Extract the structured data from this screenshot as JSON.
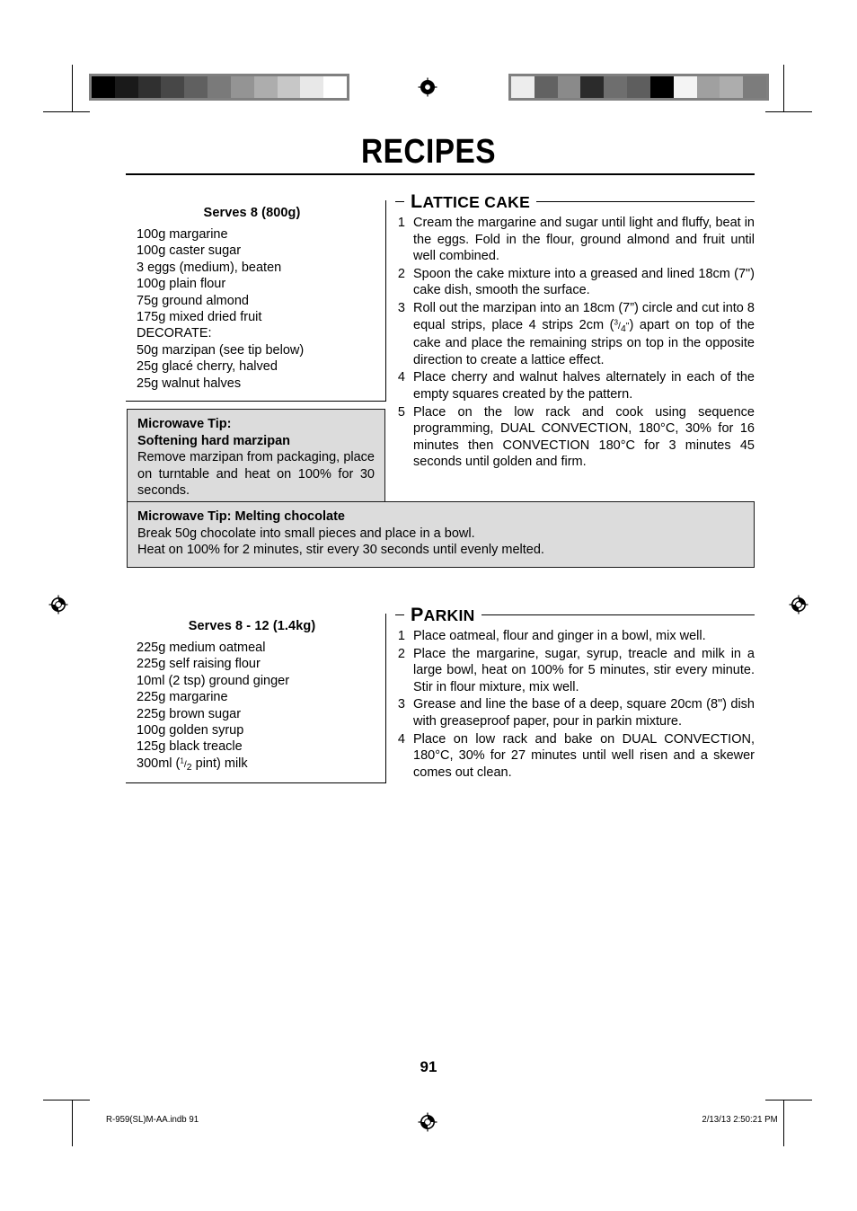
{
  "page": {
    "title": "RECIPES",
    "folio": "91"
  },
  "calibration": {
    "left_bar_swatches": [
      "#000000",
      "#1a1a1a",
      "#303030",
      "#474747",
      "#606060",
      "#7a7a7a",
      "#949494",
      "#adadad",
      "#c7c7c7",
      "#e8e8e8",
      "#ffffff"
    ],
    "right_bar_swatches": [
      "#ededed",
      "#626262",
      "#8a8a8a",
      "#2b2b2b",
      "#6e6e6e",
      "#5e5e5e",
      "#000000",
      "#f4f4f4",
      "#a0a0a0",
      "#adadad",
      "#7c7c7c"
    ]
  },
  "recipes": [
    {
      "heading_first_letter": "L",
      "heading_rest": "ATTICE CAKE",
      "serves": "Serves 8 (800g)",
      "ingredients": [
        "100g margarine",
        "100g caster sugar",
        "3 eggs (medium), beaten",
        "100g plain flour",
        "75g ground almond",
        "175g mixed dried fruit",
        "DECORATE:",
        "50g marzipan (see tip below)",
        "25g glacé cherry, halved",
        "25g walnut halves"
      ],
      "steps": [
        "Cream the margarine and sugar until light and fluffy, beat in the eggs. Fold in the flour, ground almond and fruit until well combined.",
        "Spoon the cake mixture into a greased and lined 18cm (7\") cake dish, smooth the surface.",
        "Roll out the marzipan into an 18cm (7\") circle and cut into 8 equal strips, place 4 strips 2cm (3/4\") apart on top of the cake and place the remaining strips on top in the opposite direction to create a lattice effect.",
        "Place cherry and walnut halves alternately in each of the empty squares created by the pattern.",
        "Place on the low rack and cook using sequence programming, DUAL CONVECTION, 180°C, 30% for 16 minutes then CONVECTION 180°C for 3 minutes 45 seconds until golden and firm."
      ]
    },
    {
      "heading_first_letter": "P",
      "heading_rest": "ARKIN",
      "serves": "Serves 8 - 12 (1.4kg)",
      "ingredients": [
        "225g medium oatmeal",
        "225g self raising flour",
        "10ml (2 tsp) ground ginger",
        "225g margarine",
        "225g brown sugar",
        "100g golden syrup",
        "125g black treacle",
        "300ml (1/2 pint) milk"
      ],
      "steps": [
        "Place oatmeal, flour and ginger in a bowl, mix well.",
        "Place the margarine, sugar, syrup, treacle and milk in a large bowl, heat on 100% for 5 minutes, stir every minute. Stir in flour mixture, mix well.",
        "Grease and line the base of a deep, square 20cm (8\") dish with greaseproof paper, pour in parkin mixture.",
        "Place on low rack and bake on DUAL CONVECTION, 180°C, 30% for 27 minutes until well risen and a skewer comes out clean."
      ]
    }
  ],
  "tips": [
    {
      "line1": "Microwave Tip:",
      "line2": "Softening hard marzipan",
      "body": "Remove marzipan from packaging, place on turntable and heat on 100% for 30 seconds."
    },
    {
      "line1": "Microwave Tip: Melting chocolate",
      "line2": "Break 50g chocolate into small pieces and place in a bowl.",
      "line3": "Heat on 100% for 2 minutes, stir every 30 seconds until evenly melted."
    }
  ],
  "footer": {
    "file": "R-959(SL)M-AA.indb   91",
    "timestamp": "2/13/13   2:50:21 PM"
  }
}
